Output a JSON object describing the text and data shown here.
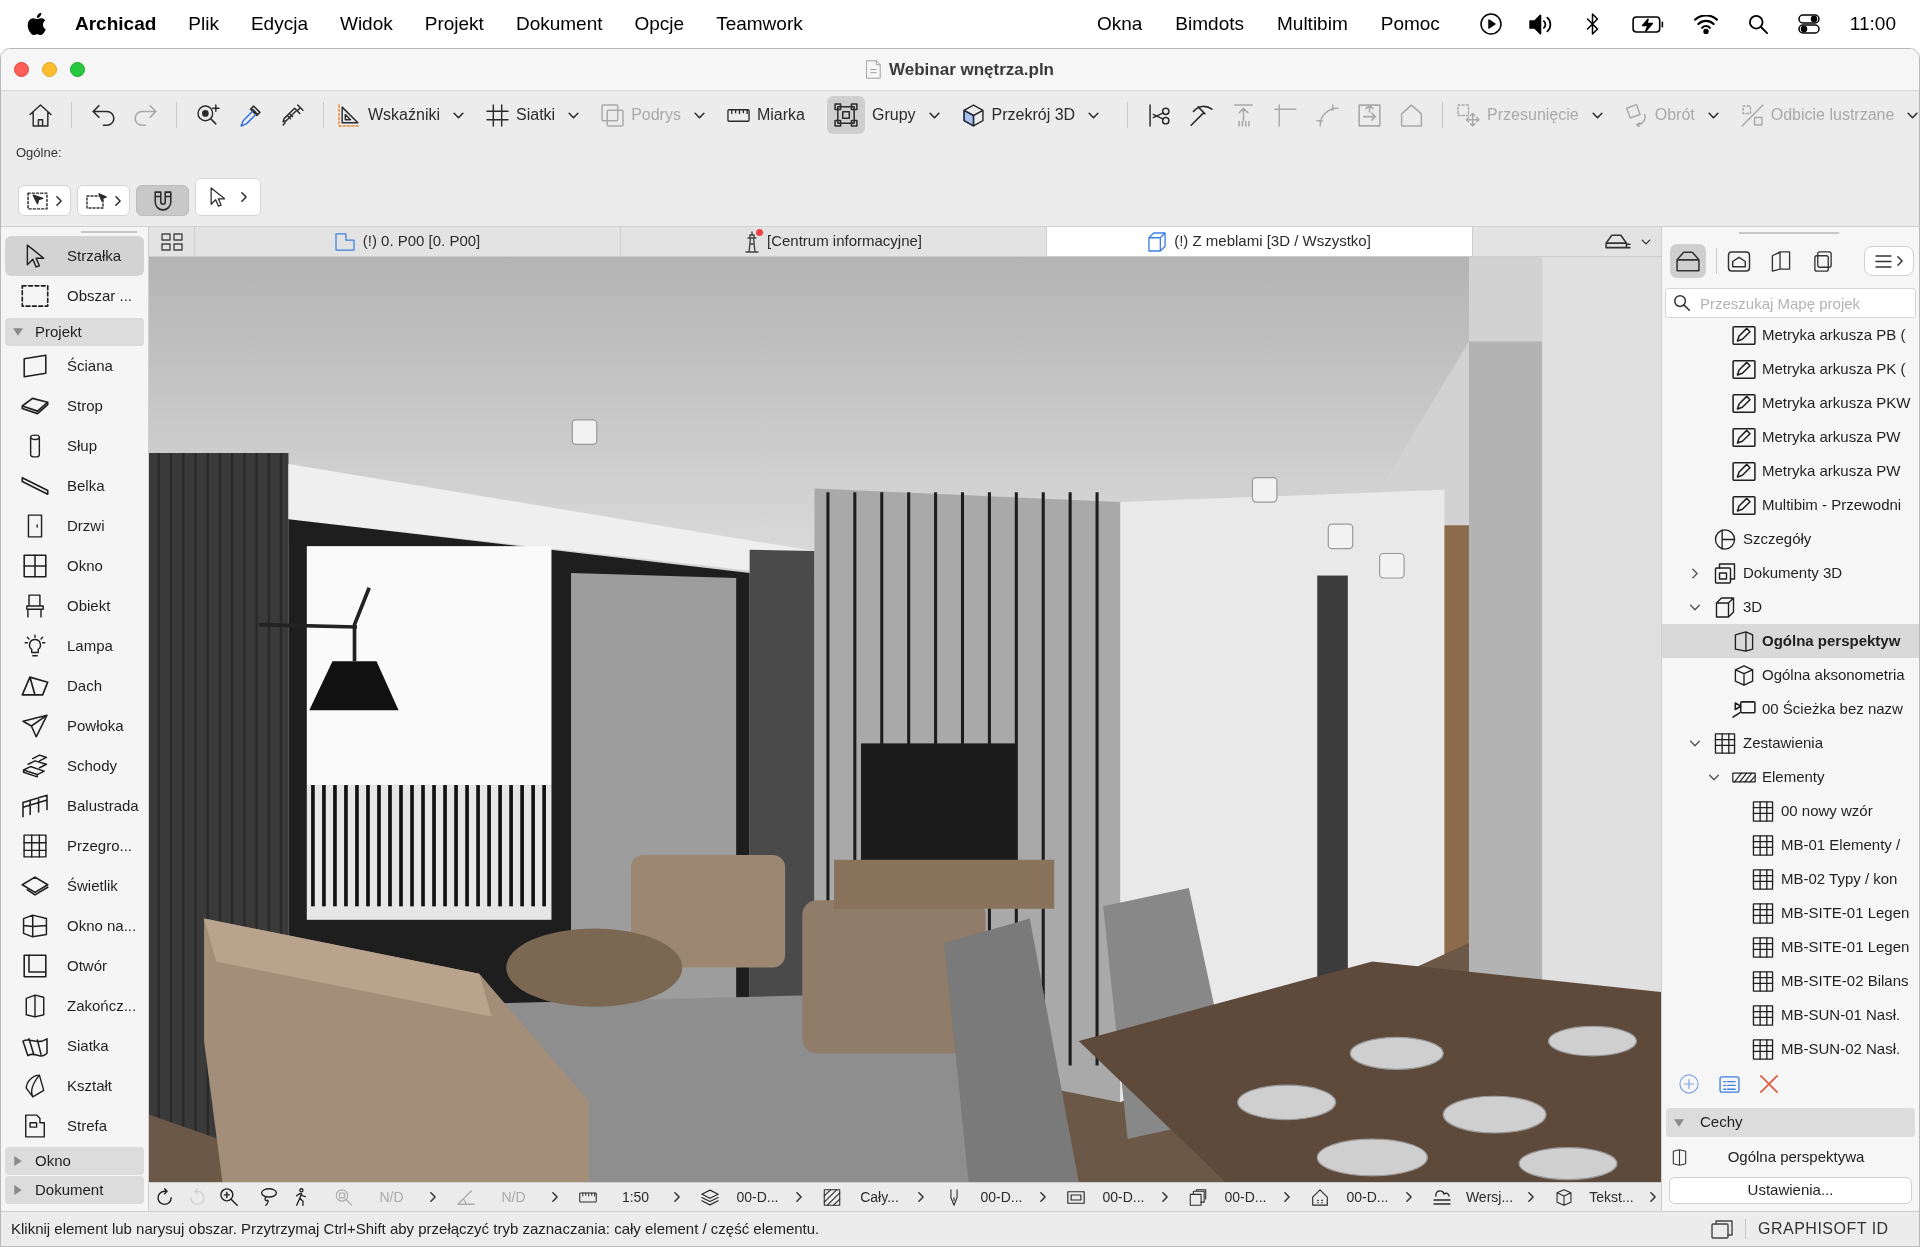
{
  "menu_bar": {
    "app_name": "Archicad",
    "menus_left": [
      "Plik",
      "Edycja",
      "Widok",
      "Projekt",
      "Dokument",
      "Opcje",
      "Teamwork"
    ],
    "menus_right": [
      "Okna",
      "Bimdots",
      "Multibim",
      "Pomoc"
    ],
    "clock": "11:00"
  },
  "window": {
    "title": "Webinar wnętrza.pln"
  },
  "toolbar": {
    "groups": [
      [
        {
          "disabled": false,
          "pressed": false
        }
      ],
      [
        {
          "disabled": false,
          "pressed": false
        },
        {
          "disabled": true,
          "pressed": false
        }
      ],
      [
        {
          "disabled": false,
          "pressed": false
        },
        {
          "disabled": false,
          "pressed": false
        },
        {
          "disabled": false,
          "pressed": false
        }
      ],
      [
        {
          "label": "Wskaźniki",
          "dropdown": true,
          "disabled": false,
          "pressed": false
        },
        {
          "label": "Siatki",
          "dropdown": true,
          "disabled": false,
          "pressed": false
        },
        {
          "label": "Podrys",
          "dropdown": true,
          "disabled": true,
          "pressed": false
        },
        {
          "label": "Miarka",
          "dropdown": false,
          "disabled": false,
          "pressed": false
        },
        {
          "label": "Grupy",
          "dropdown": true,
          "disabled": false,
          "pressed": true
        },
        {
          "label": "Przekrój 3D",
          "dropdown": true,
          "disabled": false,
          "pressed": false
        }
      ],
      [
        {
          "disabled": false,
          "pressed": false
        },
        {
          "disabled": false,
          "pressed": false
        },
        {
          "disabled": true,
          "pressed": false
        },
        {
          "disabled": true,
          "pressed": false
        },
        {
          "disabled": true,
          "pressed": false
        },
        {
          "disabled": true,
          "pressed": false
        },
        {
          "disabled": true,
          "pressed": false
        }
      ],
      [
        {
          "label": "Przesunięcie",
          "dropdown": true,
          "disabled": true,
          "pressed": false
        },
        {
          "label": "Obrót",
          "dropdown": true,
          "disabled": true,
          "pressed": false
        },
        {
          "label": "Odbicie lustrzane",
          "dropdown": true,
          "disabled": true,
          "pressed": false
        }
      ]
    ]
  },
  "info_box": {
    "label": "Ogólne:",
    "buttons": [
      {
        "pressed": false
      },
      {
        "pressed": false
      },
      {
        "pressed": true
      },
      {
        "pressed": false
      }
    ]
  },
  "toolbox": {
    "tools": [
      {
        "label": "Strzałka",
        "selected": true
      },
      {
        "label": "Obszar ...",
        "selected": false
      }
    ],
    "sections": [
      {
        "label": "Projekt",
        "expanded": true,
        "tools": [
          {
            "label": "Ściana",
            "selected": false
          },
          {
            "label": "Strop",
            "selected": false
          },
          {
            "label": "Słup",
            "selected": false
          },
          {
            "label": "Belka",
            "selected": false
          },
          {
            "label": "Drzwi",
            "selected": false
          },
          {
            "label": "Okno",
            "selected": false
          },
          {
            "label": "Obiekt",
            "selected": false
          },
          {
            "label": "Lampa",
            "selected": false
          },
          {
            "label": "Dach",
            "selected": false
          },
          {
            "label": "Powłoka",
            "selected": false
          },
          {
            "label": "Schody",
            "selected": false
          },
          {
            "label": "Balustrada",
            "selected": false
          },
          {
            "label": "Przegro...",
            "selected": false
          },
          {
            "label": "Świetlik",
            "selected": false
          },
          {
            "label": "Okno na...",
            "selected": false
          },
          {
            "label": "Otwór",
            "selected": false
          },
          {
            "label": "Zakończ...",
            "selected": false
          },
          {
            "label": "Siatka",
            "selected": false
          },
          {
            "label": "Kształt",
            "selected": false
          },
          {
            "label": "Strefa",
            "selected": false
          }
        ]
      },
      {
        "label": "Okno",
        "expanded": false
      },
      {
        "label": "Dokument",
        "expanded": false
      }
    ]
  },
  "view_tabs": [
    {
      "label": "(!) 0. P00 [0. P00]",
      "kind": "plan",
      "selected": false,
      "notification": false
    },
    {
      "label": "[Centrum informacyjne]",
      "kind": "info",
      "selected": false,
      "notification": true
    },
    {
      "label": "(!) Z meblami [3D / Wszystko]",
      "kind": "model",
      "selected": true,
      "notification": false
    }
  ],
  "navigation_bar": {
    "buttons": [
      {
        "disabled": false
      },
      {
        "disabled": true
      },
      {
        "disabled": false
      },
      {
        "disabled": false
      },
      {
        "disabled": false
      }
    ],
    "popups": [
      {
        "value": "N/D",
        "disabled": true
      },
      {
        "value": "N/D",
        "disabled": true
      },
      {
        "value": "1:50",
        "disabled": false
      },
      {
        "value": "00-D...",
        "disabled": false
      },
      {
        "value": "Cały...",
        "disabled": false
      },
      {
        "value": "00-D...",
        "disabled": false
      },
      {
        "value": "00-D...",
        "disabled": false
      },
      {
        "value": "00-D...",
        "disabled": false
      },
      {
        "value": "00-D...",
        "disabled": false
      },
      {
        "value": "Wersj...",
        "disabled": false
      },
      {
        "value": "Tekst...",
        "disabled": false
      }
    ]
  },
  "navigator": {
    "tabs": [
      {
        "selected": true
      },
      {
        "selected": false
      },
      {
        "selected": false
      },
      {
        "selected": false
      }
    ],
    "search": {
      "placeholder": "Przeszukaj Mapę projek"
    },
    "tree": [
      {
        "children": [
          {
            "label": "Metryka arkusza PB (",
            "kind": "sheet-info",
            "selected": false
          },
          {
            "label": "Metryka arkusza PK (",
            "kind": "sheet-info",
            "selected": false
          },
          {
            "label": "Metryka arkusza PKW",
            "kind": "sheet-info",
            "selected": false
          },
          {
            "label": "Metryka arkusza PW",
            "kind": "sheet-info",
            "selected": false
          },
          {
            "label": "Metryka arkusza PW",
            "kind": "sheet-info",
            "selected": false
          },
          {
            "label": "Multibim - Przewodni",
            "kind": "sheet-info",
            "selected": false
          }
        ]
      },
      {
        "label": "Szczegóły",
        "kind": "details",
        "selected": false
      },
      {
        "label": "Dokumenty 3D",
        "kind": "documents-3d",
        "selected": false,
        "expanded": false
      },
      {
        "label": "3D",
        "kind": "folder-3d",
        "selected": false,
        "expanded": true,
        "children": [
          {
            "label": "Ogólna perspektyw",
            "kind": "perspective",
            "selected": true
          },
          {
            "label": "Ogólna aksonometria",
            "kind": "axonometry",
            "selected": false
          },
          {
            "label": "00 Ścieżka bez nazw",
            "kind": "camera-path",
            "selected": false
          }
        ]
      },
      {
        "label": "Zestawienia",
        "kind": "schedules",
        "selected": false,
        "expanded": true,
        "children": [
          {
            "label": "Elementy",
            "kind": "element-schedules",
            "selected": false,
            "expanded": true,
            "children": [
              {
                "label": "00 nowy wzór",
                "kind": "schedule",
                "selected": false
              },
              {
                "label": "MB-01 Elementy /",
                "kind": "schedule",
                "selected": false
              },
              {
                "label": "MB-02 Typy / kon",
                "kind": "schedule",
                "selected": false
              },
              {
                "label": "MB-SITE-01 Legen",
                "kind": "schedule",
                "selected": false
              },
              {
                "label": "MB-SITE-01 Legen",
                "kind": "schedule",
                "selected": false
              },
              {
                "label": "MB-SITE-02 Bilans",
                "kind": "schedule",
                "selected": false
              },
              {
                "label": "MB-SUN-01 Nasł.",
                "kind": "schedule",
                "selected": false
              },
              {
                "label": "MB-SUN-02 Nasł.",
                "kind": "schedule",
                "selected": false
              }
            ]
          }
        ]
      }
    ],
    "properties": {
      "label": "Cechy",
      "expanded": true,
      "view_name": "Ogólna perspektywa",
      "settings_button": "Ustawienia..."
    }
  },
  "status_bar": {
    "message": "Kliknij element lub narysuj obszar. Przytrzymaj Ctrl+Shift aby przełączyć tryb zaznaczania: cały element / część elementu.",
    "account": "GRAPHISOFT ID"
  }
}
